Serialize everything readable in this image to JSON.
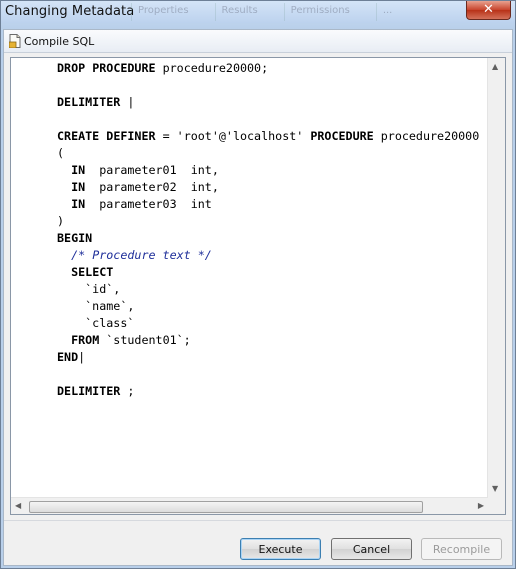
{
  "window": {
    "title": "Changing Metadata",
    "close_glyph": "✕"
  },
  "background_tabs": [
    "Properties",
    "Results",
    "Permissions",
    "..."
  ],
  "toolbar": {
    "compile_label": "Compile SQL"
  },
  "code_lines": [
    "DROP PROCEDURE procedure20000;",
    "",
    "DELIMITER |",
    "",
    "CREATE DEFINER = 'root'@'localhost' PROCEDURE procedure20000",
    "(",
    "  IN  parameter01  int,",
    "  IN  parameter02  int,",
    "  IN  parameter03  int",
    ")",
    "BEGIN",
    "  /* Procedure text */",
    "  SELECT",
    "    `id`,",
    "    `name`,",
    "    `class`",
    "  FROM `student01`;",
    "END|",
    "",
    "DELIMITER ;"
  ],
  "buttons": {
    "execute": "Execute",
    "cancel": "Cancel",
    "recompile": "Recompile"
  },
  "colors": {
    "comment": "#1f2f9a",
    "window_frame": "#b8cfea",
    "close_button": "#c7432b"
  }
}
